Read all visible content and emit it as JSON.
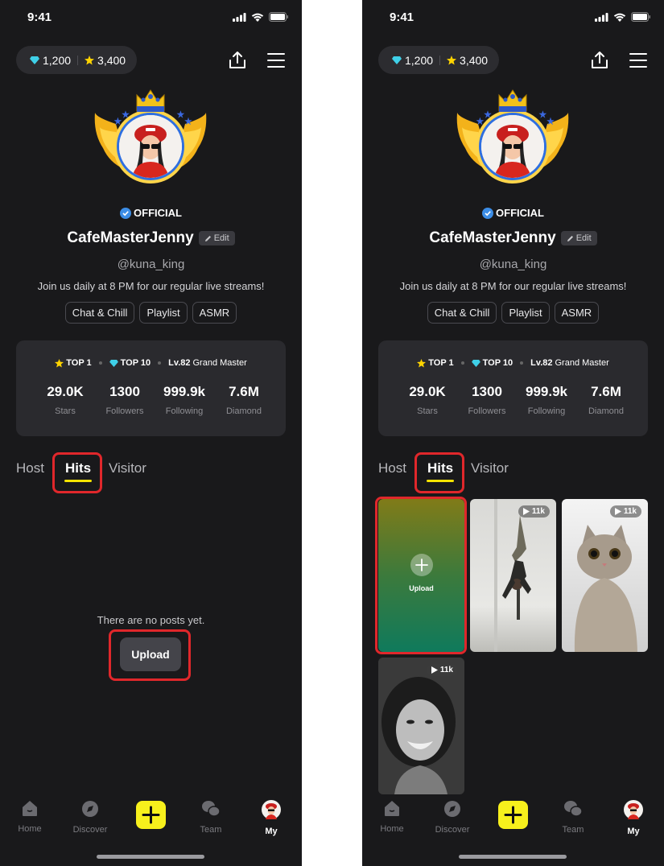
{
  "status": {
    "time": "9:41"
  },
  "wallet": {
    "diamonds": "1,200",
    "stars": "3,400"
  },
  "profile": {
    "official_label": "OFFICIAL",
    "name": "CafeMasterJenny",
    "edit_label": "Edit",
    "handle": "@kuna_king",
    "bio": "Join us daily at 8 PM for our regular live streams!",
    "tags": [
      "Chat & Chill",
      "Playlist",
      "ASMR"
    ]
  },
  "ranks": {
    "top_star": "TOP 1",
    "top_diamond": "TOP 10",
    "level": "Lv.82",
    "level_title": "Grand Master"
  },
  "stats": [
    {
      "value": "29.0K",
      "label": "Stars"
    },
    {
      "value": "1300",
      "label": "Followers"
    },
    {
      "value": "999.9k",
      "label": "Following"
    },
    {
      "value": "7.6M",
      "label": "Diamond"
    }
  ],
  "tabs": [
    "Host",
    "Hits",
    "Visitor"
  ],
  "active_tab": "Hits",
  "empty_state": {
    "message": "There are no posts yet.",
    "button": "Upload"
  },
  "grid": {
    "upload_label": "Upload",
    "views": [
      "11k",
      "11k",
      "11k"
    ]
  },
  "nav": {
    "items": [
      "Home",
      "Discover",
      "Team",
      "My"
    ],
    "active": "My"
  },
  "colors": {
    "accent_yellow": "#f5e400",
    "highlight_red": "#e0272b",
    "background": "#19191b",
    "diamond": "#3fd0e8",
    "star": "#ffd400"
  }
}
